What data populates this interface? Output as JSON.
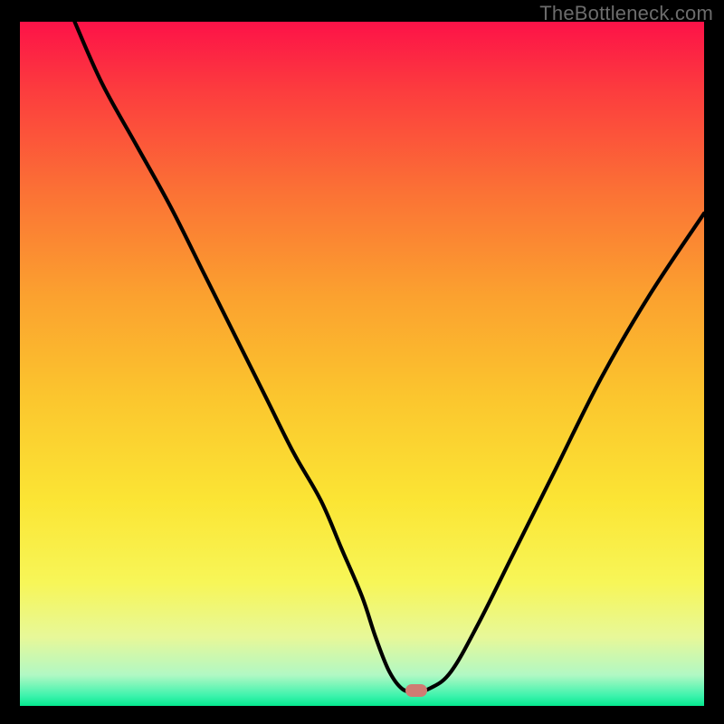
{
  "watermark": "TheBottleneck.com",
  "colors": {
    "bg_black": "#000000",
    "marker": "#cf7c73",
    "curve": "#000000",
    "gradient_stops": [
      {
        "offset": 0.0,
        "color": "#fd1248"
      },
      {
        "offset": 0.1,
        "color": "#fc3c3e"
      },
      {
        "offset": 0.25,
        "color": "#fb7235"
      },
      {
        "offset": 0.4,
        "color": "#fba12f"
      },
      {
        "offset": 0.55,
        "color": "#fbc62e"
      },
      {
        "offset": 0.7,
        "color": "#fbe534"
      },
      {
        "offset": 0.82,
        "color": "#f7f658"
      },
      {
        "offset": 0.9,
        "color": "#e7f899"
      },
      {
        "offset": 0.955,
        "color": "#b1f8c4"
      },
      {
        "offset": 0.985,
        "color": "#3ef3ad"
      },
      {
        "offset": 1.0,
        "color": "#06e98f"
      }
    ]
  },
  "chart_data": {
    "type": "line",
    "title": "",
    "xlabel": "",
    "ylabel": "",
    "xlim": [
      0,
      100
    ],
    "ylim": [
      0,
      100
    ],
    "marker": {
      "x": 58,
      "y": 2.2
    },
    "series": [
      {
        "name": "curve",
        "x": [
          8,
          12,
          17,
          22,
          27,
          32,
          36,
          40,
          44,
          47,
          50,
          52,
          54,
          56,
          58,
          60,
          63,
          67,
          72,
          78,
          85,
          92,
          100
        ],
        "y": [
          100,
          91,
          82,
          73,
          63,
          53,
          45,
          37,
          30,
          23,
          16,
          10,
          5,
          2.4,
          2.2,
          2.6,
          5,
          12,
          22,
          34,
          48,
          60,
          72
        ]
      }
    ]
  }
}
